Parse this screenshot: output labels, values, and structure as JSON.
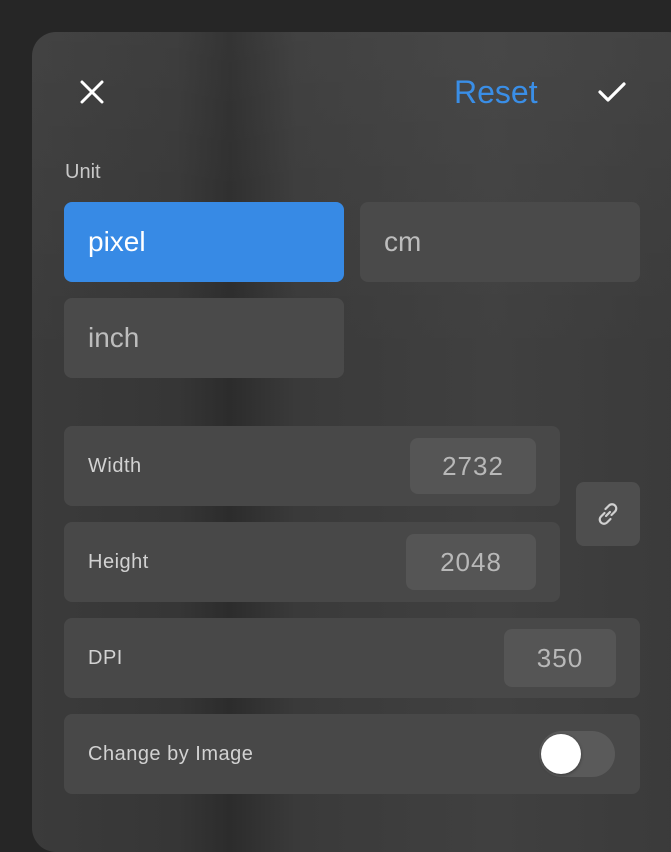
{
  "header": {
    "close_icon": "close-icon",
    "reset_label": "Reset",
    "confirm_icon": "checkmark-icon",
    "accent_color": "#3a8ee6"
  },
  "unit": {
    "label": "Unit",
    "options": [
      "pixel",
      "cm",
      "inch"
    ],
    "selected": "pixel"
  },
  "dimensions": {
    "width": {
      "label": "Width",
      "value": "2732"
    },
    "height": {
      "label": "Height",
      "value": "2048"
    },
    "link_icon": "link-icon",
    "dpi": {
      "label": "DPI",
      "value": "350"
    }
  },
  "change_by_image": {
    "label": "Change by Image",
    "enabled": false
  }
}
